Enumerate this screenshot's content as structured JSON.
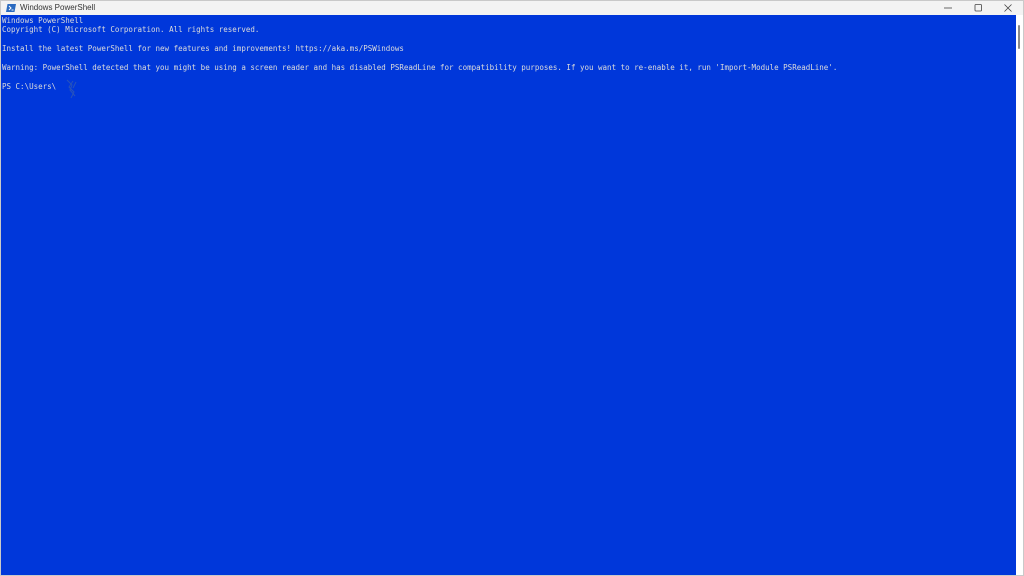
{
  "window": {
    "title": "Windows PowerShell",
    "controls": {
      "minimize": "—",
      "maximize": "☐",
      "close": "✕"
    }
  },
  "console": {
    "background": "#0037da",
    "foreground": "#dcdcdc",
    "lines": {
      "banner_1": "Windows PowerShell",
      "banner_2": "Copyright (C) Microsoft Corporation. All rights reserved.",
      "install_hint": "Install the latest PowerShell for new features and improvements! https://aka.ms/PSWindows",
      "warning": "Warning: PowerShell detected that you might be using a screen reader and has disabled PSReadLine for compatibility purposes. If you want to re-enable it, run 'Import-Module PSReadLine'.",
      "prompt": "PS C:\\Users\\"
    }
  }
}
